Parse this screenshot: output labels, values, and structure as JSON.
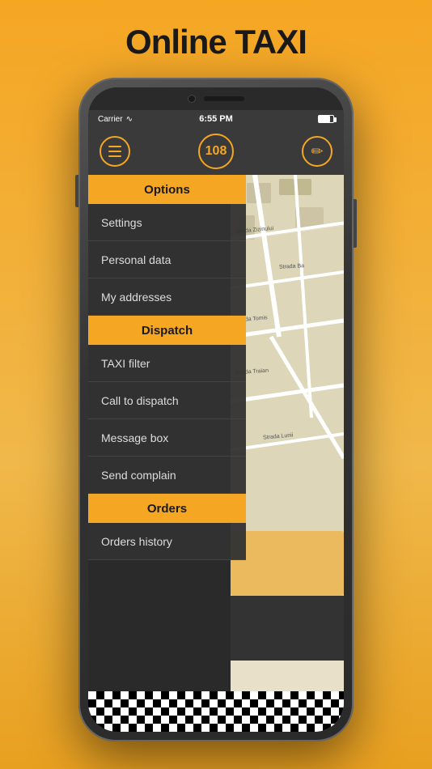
{
  "page": {
    "title": "Online TAXI"
  },
  "status_bar": {
    "carrier": "Carrier",
    "wifi": "▲",
    "time": "6:55 PM",
    "battery": "■"
  },
  "header": {
    "badge": "108",
    "hamburger_label": "menu",
    "edit_label": "edit"
  },
  "menu": {
    "sections": [
      {
        "label": "Options",
        "items": [
          {
            "label": "Settings"
          },
          {
            "label": "Personal data"
          },
          {
            "label": "My addresses"
          }
        ]
      },
      {
        "label": "Dispatch",
        "items": [
          {
            "label": "TAXI filter"
          },
          {
            "label": "Call to dispatch"
          },
          {
            "label": "Message box"
          },
          {
            "label": "Send complain"
          }
        ]
      },
      {
        "label": "Orders",
        "items": [
          {
            "label": "Orders history"
          }
        ]
      }
    ]
  },
  "map": {
    "labels": [
      "Strada Zizinului",
      "Strada Ba",
      "Strada Tomis",
      "Strada Traian",
      "Strada Lunii"
    ]
  }
}
